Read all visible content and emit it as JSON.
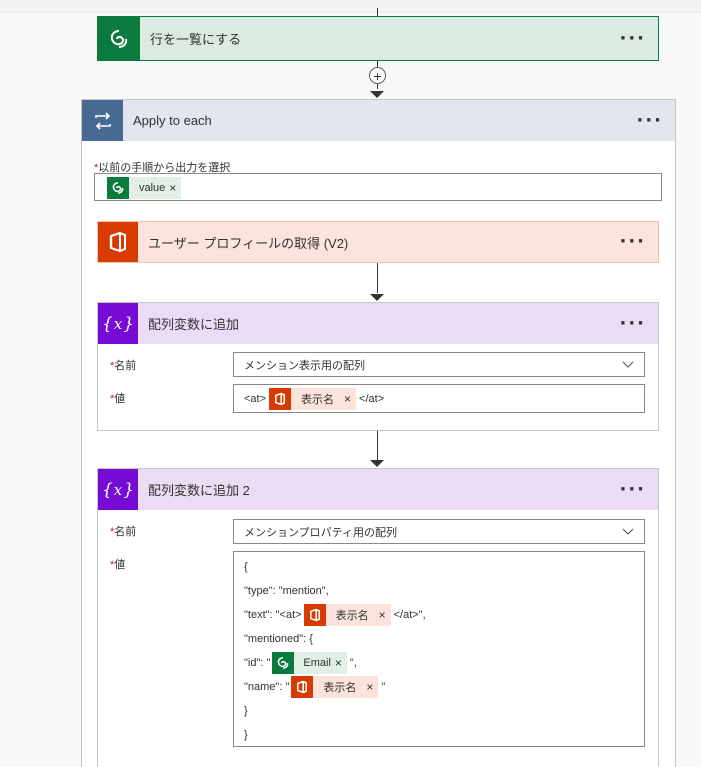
{
  "list_rows": {
    "title": "行を一覧にする",
    "more": "···"
  },
  "apply_each": {
    "title": "Apply to each",
    "more": "···",
    "select_label": "以前の手順から出力を選択",
    "required_mark": "*",
    "token": {
      "label": "value",
      "remove": "×"
    }
  },
  "get_profile": {
    "title": "ユーザー プロフィールの取得 (V2)",
    "more": "···"
  },
  "append1": {
    "title": "配列変数に追加",
    "more": "···",
    "name_label": "名前",
    "name_value": "メンション表示用の配列",
    "value_label": "値",
    "value_prefix": "<at>",
    "token": {
      "label": "表示名",
      "remove": "×"
    },
    "value_suffix": "</at>"
  },
  "append2": {
    "title": "配列変数に追加 2",
    "more": "···",
    "name_label": "名前",
    "name_value": "メンションプロパティ用の配列",
    "value_label": "値",
    "lines": {
      "l1": "{",
      "l2": "\"type\": \"mention\",",
      "l3_pre": "\"text\": \"<at>",
      "l3_post": "</at>\",",
      "l4": "\"mentioned\": {",
      "l5_pre": "\"id\": \"",
      "l5_post": "\",",
      "l6_pre": "\"name\": \"",
      "l6_post": "\"",
      "l7": "}",
      "l8": "}"
    },
    "token_display_name": {
      "label": "表示名",
      "remove": "×"
    },
    "token_email": {
      "label": "Email",
      "remove": "×"
    }
  },
  "add_step": "+",
  "colors": {
    "dataverse": "#0b7a3e",
    "office": "#d83b01",
    "variable": "#770bd6",
    "loop": "#486991"
  },
  "icons": {
    "dataverse": "dataverse-icon",
    "loop": "loop-icon",
    "office": "office-icon",
    "variable": "variable-icon",
    "chevron": "chevron-down-icon"
  }
}
